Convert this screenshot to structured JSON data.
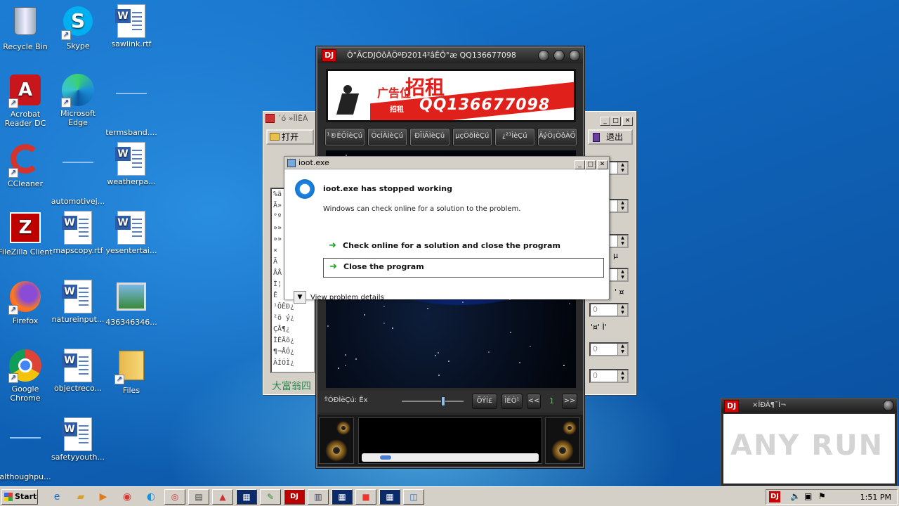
{
  "desktop": {
    "icons": [
      {
        "label": "Recycle Bin",
        "icon": "recycle-bin-icon"
      },
      {
        "label": "Skype",
        "icon": "skype-icon"
      },
      {
        "label": "sawlink.rtf",
        "icon": "word-doc-icon"
      },
      {
        "label": "Acrobat Reader DC",
        "icon": "acrobat-icon"
      },
      {
        "label": "Microsoft Edge",
        "icon": "edge-icon"
      },
      {
        "label": "termsband....",
        "icon": "blank-file-icon"
      },
      {
        "label": "CCleaner",
        "icon": "ccleaner-icon"
      },
      {
        "label": "automotivej...",
        "icon": "blank-file-icon"
      },
      {
        "label": "weatherpa...",
        "icon": "word-doc-icon"
      },
      {
        "label": "FileZilla Client",
        "icon": "filezilla-icon"
      },
      {
        "label": "mapscopy.rtf",
        "icon": "word-doc-icon"
      },
      {
        "label": "yesentertai...",
        "icon": "word-doc-icon"
      },
      {
        "label": "Firefox",
        "icon": "firefox-icon"
      },
      {
        "label": "natureinput...",
        "icon": "word-doc-icon"
      },
      {
        "label": "436346346...",
        "icon": "image-file-icon"
      },
      {
        "label": "Google Chrome",
        "icon": "chrome-icon"
      },
      {
        "label": "objectreco...",
        "icon": "word-doc-icon"
      },
      {
        "label": "Files",
        "icon": "folder-icon"
      },
      {
        "label": "althoughpu...",
        "icon": "blank-file-icon"
      },
      {
        "label": "safetyyouth...",
        "icon": "word-doc-icon"
      }
    ]
  },
  "dj_player": {
    "title": "Ô°ÃCDJÓôÀÖºÐ2014²âÊÔ°æ QQ136677098",
    "logo": "DJ",
    "banner": {
      "headline": "招租",
      "ad_text": "广告位",
      "qq_small": "招租",
      "qq_number": "QQ136677098"
    },
    "tabs": [
      "¹®ÉÕÌèÇú",
      "ÓcÍÀÌèÇú",
      "ÐÏÍÃÌèÇú",
      "µçÒõÌèÇú",
      "¿²¹ÌèÇú",
      "ÂýÒ¡ÒôÀÖ"
    ],
    "status_label": "ºÓÐÌèÇú: Êx",
    "buttons": {
      "btn1": "ÕÝÍ£",
      "btn2": "ÌÉÒ¹",
      "prev": "<<",
      "page": "1",
      "next": ">>"
    }
  },
  "bg_window": {
    "title": "´ó »ÎÌÊÀ",
    "open_button": "打开",
    "exit_button": "退出",
    "footer_text": "大富翁四",
    "list_rows": [
      "%ä",
      "Ã»",
      "°º",
      "»»",
      "»»",
      "×",
      "Ã",
      "ÅÅ",
      "Ì¦",
      "Ê",
      "¹ÔÊÐ¿",
      "²ö ý¿",
      "ÇÅ¶¿",
      "ÌÉÄõ¿",
      "¶¬ÅÓ¿",
      "ÂÍÓÌ¿"
    ],
    "spin_values": [
      "",
      "",
      "",
      "",
      "0",
      "0",
      "0"
    ],
    "side_labels": [
      "µ",
      "' ¤",
      "'¤' Ì'"
    ]
  },
  "error_dialog": {
    "title": "ioot.exe",
    "heading": "ioot.exe has stopped working",
    "message": "Windows can check online for a solution to the problem.",
    "option_check": "Check online for a solution and close the program",
    "option_close": "Close the program",
    "details": "View problem details"
  },
  "mini_window": {
    "logo": "DJ",
    "title": "×ÎÐÂ¶¯Ì¬",
    "watermark": "ANY RUN"
  },
  "taskbar": {
    "start_label": "Start",
    "clock": "1:51 PM"
  }
}
